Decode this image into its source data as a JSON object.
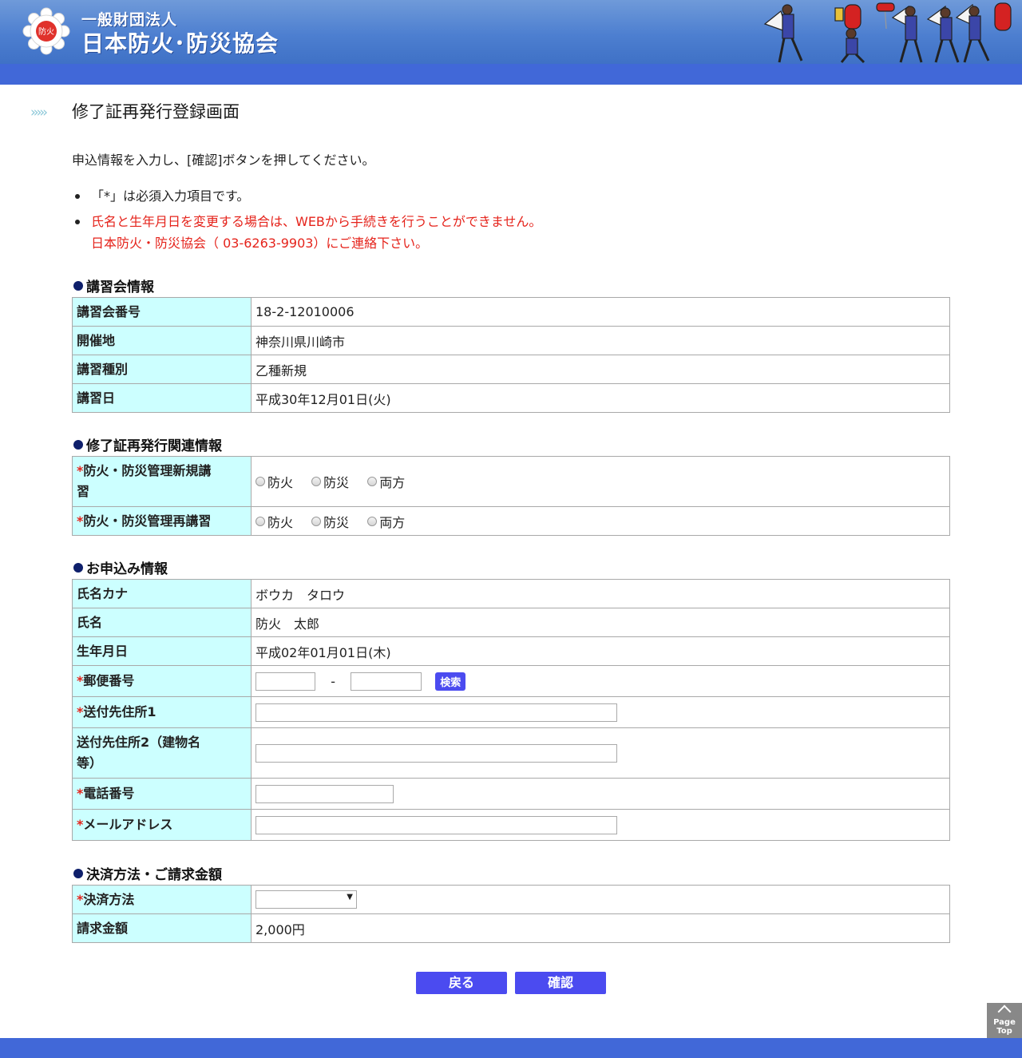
{
  "header": {
    "logo_text": "防火",
    "org_small": "一般財団法人",
    "org_name": "日本防火･防災協会"
  },
  "page": {
    "title": "修了証再発行登録画面",
    "intro": "申込情報を入力し、[確認]ボタンを押してください。",
    "notes": [
      "「*」は必須入力項目です。",
      "氏名と生年月日を変更する場合は、WEBから手続きを行うことができません。",
      "日本防火・防災協会（ 03-6263-9903）にご連絡下さい。"
    ]
  },
  "sections": {
    "course": {
      "heading": "講習会情報",
      "rows": [
        {
          "label": "講習会番号",
          "value": "18-2-12010006"
        },
        {
          "label": "開催地",
          "value": "神奈川県川崎市"
        },
        {
          "label": "講習種別",
          "value": "乙種新規"
        },
        {
          "label": "講習日",
          "value": "平成30年12月01日(火)"
        }
      ]
    },
    "reissue": {
      "heading": "修了証再発行関連情報",
      "rows": [
        {
          "label_line1": "防火・防災管理新規講",
          "label_line2": "習",
          "options": [
            "防火",
            "防災",
            "両方"
          ]
        },
        {
          "label": "防火・防災管理再講習",
          "options": [
            "防火",
            "防災",
            "両方"
          ]
        }
      ]
    },
    "applicant": {
      "heading": "お申込み情報",
      "rows": {
        "kana": {
          "label": "氏名カナ",
          "value": "ボウカ　タロウ"
        },
        "name": {
          "label": "氏名",
          "value": "防火　太郎"
        },
        "birth": {
          "label": "生年月日",
          "value": "平成02年01月01日(木)"
        },
        "postal": {
          "label": "郵便番号",
          "separator": "-",
          "search_label": "検索"
        },
        "address1": {
          "label": "送付先住所1"
        },
        "address2": {
          "label_line1": "送付先住所2（建物名",
          "label_line2": "等）"
        },
        "phone": {
          "label": "電話番号"
        },
        "email": {
          "label": "メールアドレス"
        }
      }
    },
    "payment": {
      "heading": "決済方法・ご請求金額",
      "method_label": "決済方法",
      "method_value": "",
      "amount_label": "請求金額",
      "amount_value": "2,000円"
    }
  },
  "required_mark": "*",
  "buttons": {
    "back": "戻る",
    "confirm": "確認"
  },
  "page_top": {
    "line1": "Page",
    "line2": "Top"
  },
  "colors": {
    "header_blue": "#4d7fd0",
    "bar_blue": "#4168d8",
    "label_bg": "#ccffff",
    "button_blue": "#4b4bf0",
    "required_red": "#e5231b",
    "section_dot": "#0e1f6b"
  }
}
